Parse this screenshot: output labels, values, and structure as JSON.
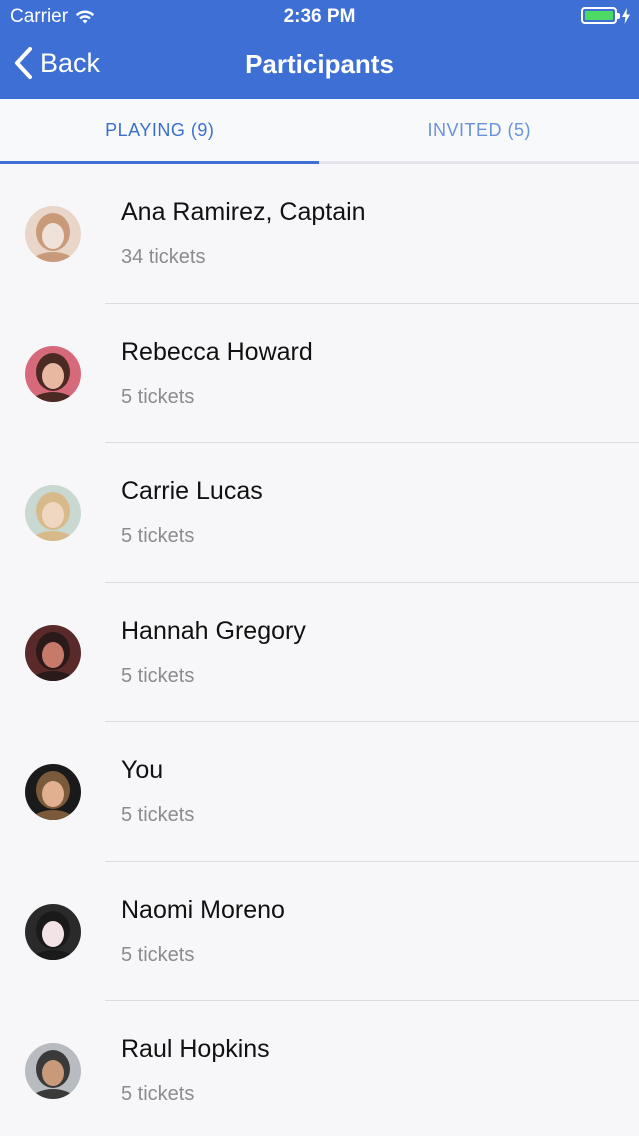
{
  "status_bar": {
    "carrier": "Carrier",
    "time": "2:36 PM",
    "battery_level": 1.0
  },
  "nav": {
    "back_label": "Back",
    "title": "Participants"
  },
  "tabs": [
    {
      "label": "PLAYING (9)",
      "active": true
    },
    {
      "label": "INVITED (5)",
      "active": false
    }
  ],
  "participants": [
    {
      "name": "Ana Ramirez, Captain",
      "tickets": "34 tickets",
      "avatar_colors": [
        "#e9d6c8",
        "#c99a7a",
        "#f0e2d8"
      ]
    },
    {
      "name": "Rebecca Howard",
      "tickets": "5 tickets",
      "avatar_colors": [
        "#d76a7a",
        "#4a2a22",
        "#e8b9a0"
      ]
    },
    {
      "name": "Carrie Lucas",
      "tickets": "5 tickets",
      "avatar_colors": [
        "#c9d8d0",
        "#d8b98a",
        "#f0d7c2"
      ]
    },
    {
      "name": "Hannah Gregory",
      "tickets": "5 tickets",
      "avatar_colors": [
        "#5a2a2a",
        "#2a1a1a",
        "#c87a6a"
      ]
    },
    {
      "name": "You",
      "tickets": "5 tickets",
      "avatar_colors": [
        "#1a1a1a",
        "#7a5a3a",
        "#e0b090"
      ]
    },
    {
      "name": "Naomi Moreno",
      "tickets": "5 tickets",
      "avatar_colors": [
        "#2a2a2a",
        "#1a1a1a",
        "#f2e4e6"
      ]
    },
    {
      "name": "Raul Hopkins",
      "tickets": "5 tickets",
      "avatar_colors": [
        "#b8bcc0",
        "#3a3a3a",
        "#c89a7a"
      ]
    }
  ]
}
